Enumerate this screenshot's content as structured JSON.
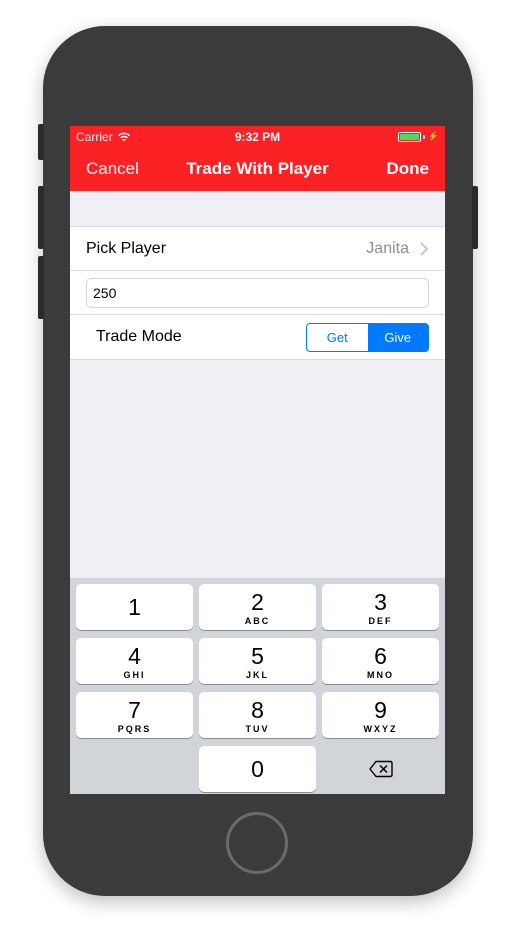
{
  "status_bar": {
    "carrier": "Carrier",
    "time": "9:32 PM"
  },
  "nav": {
    "left": "Cancel",
    "title": "Trade With Player",
    "right": "Done"
  },
  "form": {
    "pick_player_label": "Pick Player",
    "pick_player_value": "Janita",
    "amount_value": "250",
    "trade_mode_label": "Trade Mode",
    "trade_mode_options": [
      "Get",
      "Give"
    ],
    "trade_mode_selected": "Give"
  },
  "keypad": {
    "keys": [
      {
        "digit": "1",
        "letters": ""
      },
      {
        "digit": "2",
        "letters": "ABC"
      },
      {
        "digit": "3",
        "letters": "DEF"
      },
      {
        "digit": "4",
        "letters": "GHI"
      },
      {
        "digit": "5",
        "letters": "JKL"
      },
      {
        "digit": "6",
        "letters": "MNO"
      },
      {
        "digit": "7",
        "letters": "PQRS"
      },
      {
        "digit": "8",
        "letters": "TUV"
      },
      {
        "digit": "9",
        "letters": "WXYZ"
      },
      {
        "digit": "0",
        "letters": ""
      }
    ]
  },
  "colors": {
    "nav_bar": "#fc2125",
    "accent": "#007aff",
    "battery": "#4cd964"
  },
  "icons": {
    "wifi": "wifi-icon",
    "battery": "battery-icon",
    "chevron": "chevron-right-icon",
    "delete": "backspace-icon"
  }
}
